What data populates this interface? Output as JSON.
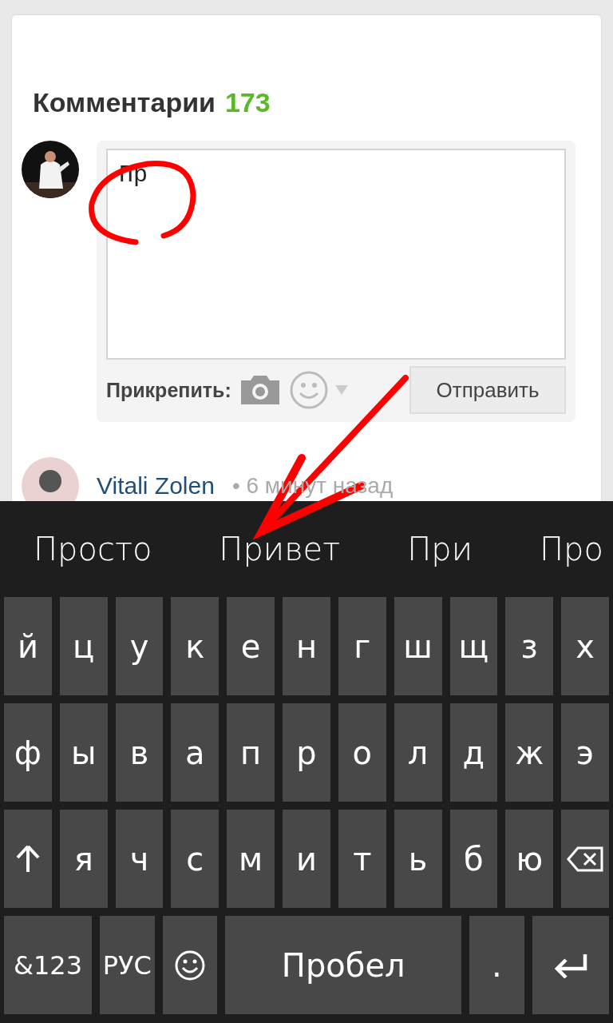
{
  "comments": {
    "title": "Комментарии",
    "count": "173"
  },
  "compose": {
    "value": "Пр",
    "attach_label": "Прикрепить:",
    "submit": "Отправить"
  },
  "next_comment": {
    "author": "Vitali Zolen",
    "time": "• 6 минут назад"
  },
  "keyboard": {
    "suggestions": [
      "Просто",
      "Привет",
      "При",
      "Про"
    ],
    "rows": [
      [
        {
          "kind": "char",
          "label": "й"
        },
        {
          "kind": "char",
          "label": "ц"
        },
        {
          "kind": "char",
          "label": "у"
        },
        {
          "kind": "char",
          "label": "к"
        },
        {
          "kind": "char",
          "label": "е"
        },
        {
          "kind": "char",
          "label": "н"
        },
        {
          "kind": "char",
          "label": "г"
        },
        {
          "kind": "char",
          "label": "ш"
        },
        {
          "kind": "char",
          "label": "щ"
        },
        {
          "kind": "char",
          "label": "з"
        },
        {
          "kind": "char",
          "label": "х"
        }
      ],
      [
        {
          "kind": "char",
          "label": "ф"
        },
        {
          "kind": "char",
          "label": "ы"
        },
        {
          "kind": "char",
          "label": "в"
        },
        {
          "kind": "char",
          "label": "а"
        },
        {
          "kind": "char",
          "label": "п"
        },
        {
          "kind": "char",
          "label": "р"
        },
        {
          "kind": "char",
          "label": "о"
        },
        {
          "kind": "char",
          "label": "л"
        },
        {
          "kind": "char",
          "label": "д"
        },
        {
          "kind": "char",
          "label": "ж"
        },
        {
          "kind": "char",
          "label": "э"
        }
      ],
      [
        {
          "kind": "shift"
        },
        {
          "kind": "char",
          "label": "я"
        },
        {
          "kind": "char",
          "label": "ч"
        },
        {
          "kind": "char",
          "label": "с"
        },
        {
          "kind": "char",
          "label": "м"
        },
        {
          "kind": "char",
          "label": "и"
        },
        {
          "kind": "char",
          "label": "т"
        },
        {
          "kind": "char",
          "label": "ь"
        },
        {
          "kind": "char",
          "label": "б"
        },
        {
          "kind": "char",
          "label": "ю"
        },
        {
          "kind": "backspace"
        }
      ]
    ],
    "bottom_row": [
      {
        "kind": "symbols",
        "label": "&123"
      },
      {
        "kind": "lang",
        "label": "РУС"
      },
      {
        "kind": "emoji"
      },
      {
        "kind": "space",
        "label": "Пробел"
      },
      {
        "kind": "char",
        "label": "."
      },
      {
        "kind": "enter"
      }
    ]
  }
}
